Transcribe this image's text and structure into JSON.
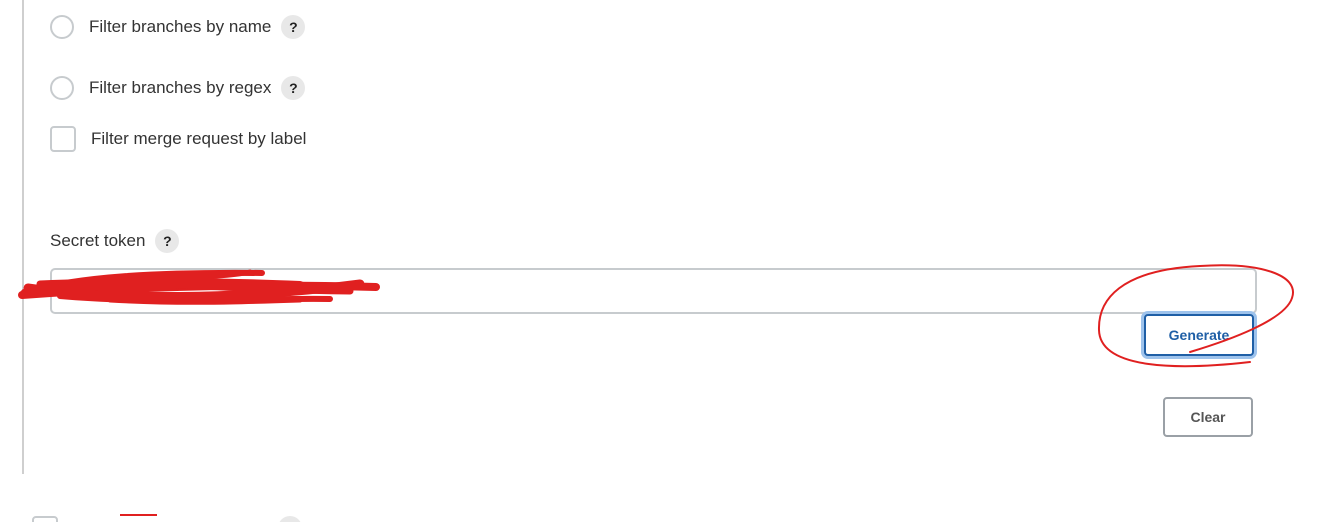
{
  "options": {
    "filter_by_name": {
      "label": "Filter branches by name",
      "help": "?"
    },
    "filter_by_regex": {
      "label": "Filter branches by regex",
      "help": "?"
    },
    "filter_mr_label": {
      "label": "Filter merge request by label"
    }
  },
  "secret_token": {
    "label": "Secret token",
    "help": "?",
    "value": ""
  },
  "buttons": {
    "generate": "Generate",
    "clear": "Clear"
  },
  "colors": {
    "accent": "#1f5fa6",
    "annotation": "#e02020"
  }
}
